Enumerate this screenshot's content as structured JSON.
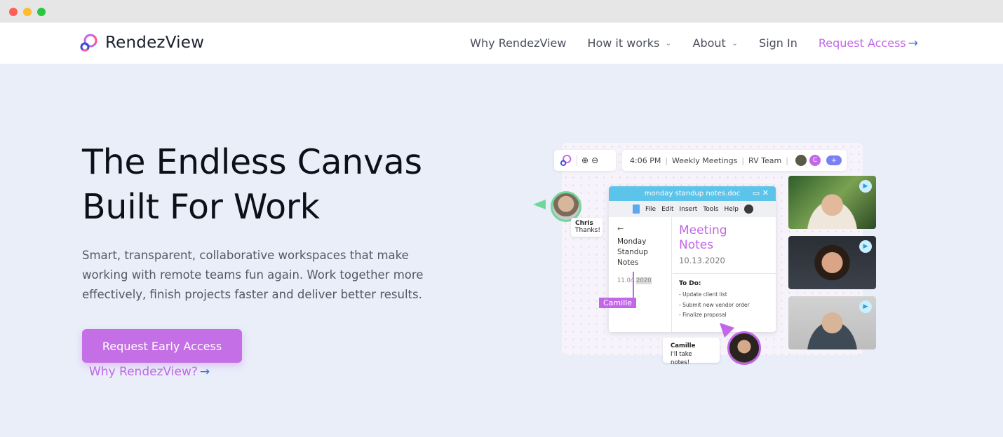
{
  "brand": {
    "name": "RendezView",
    "accent": "#c167e8",
    "link_arrow_color": "#3b6fe0",
    "hero_bg": "#e9eef9"
  },
  "nav": {
    "items": [
      {
        "label": "Why RendezView",
        "has_dropdown": false
      },
      {
        "label": "How it works",
        "has_dropdown": true
      },
      {
        "label": "About",
        "has_dropdown": true
      },
      {
        "label": "Sign In",
        "has_dropdown": false
      }
    ],
    "cta_label": "Request Access",
    "cta_arrow": "→",
    "dropdown_icon": "chevron-down-icon"
  },
  "hero": {
    "title_line1": "The Endless Canvas",
    "title_line2": "Built For Work",
    "subtitle": "Smart, transparent, collaborative workspaces that make working with remote teams fun again. Work together more effectively, finish projects faster and deliver better results.",
    "primary_button": "Request Early Access",
    "secondary_link": "Why RendezView?",
    "secondary_arrow": "→"
  },
  "illustration": {
    "toolbar": {
      "time": "4:06 PM",
      "meeting": "Weekly Meetings",
      "team": "RV Team",
      "avatar_c": "C",
      "plus": "+"
    },
    "doc": {
      "filename": "monday standup notes.doc",
      "menu": [
        "File",
        "Edit",
        "Insert",
        "Tools",
        "Help"
      ],
      "sidebar_title_1": "Monday",
      "sidebar_title_2": "Standup",
      "sidebar_title_3": "Notes",
      "sidebar_date_a": "11.04.",
      "sidebar_date_b": "2020",
      "heading_1": "Meeting",
      "heading_2": "Notes",
      "date": "10.13.2020",
      "todo_title": "To Do:",
      "todo_items": [
        "- Update client list",
        "- Submit new vendor order",
        "- Finalize proposal"
      ]
    },
    "cursor_label": "Camille",
    "chris_bubble": {
      "name": "Chris",
      "message": "Thanks!"
    },
    "camille_bubble": {
      "name": "Camille",
      "message": "I'll take notes!"
    }
  }
}
